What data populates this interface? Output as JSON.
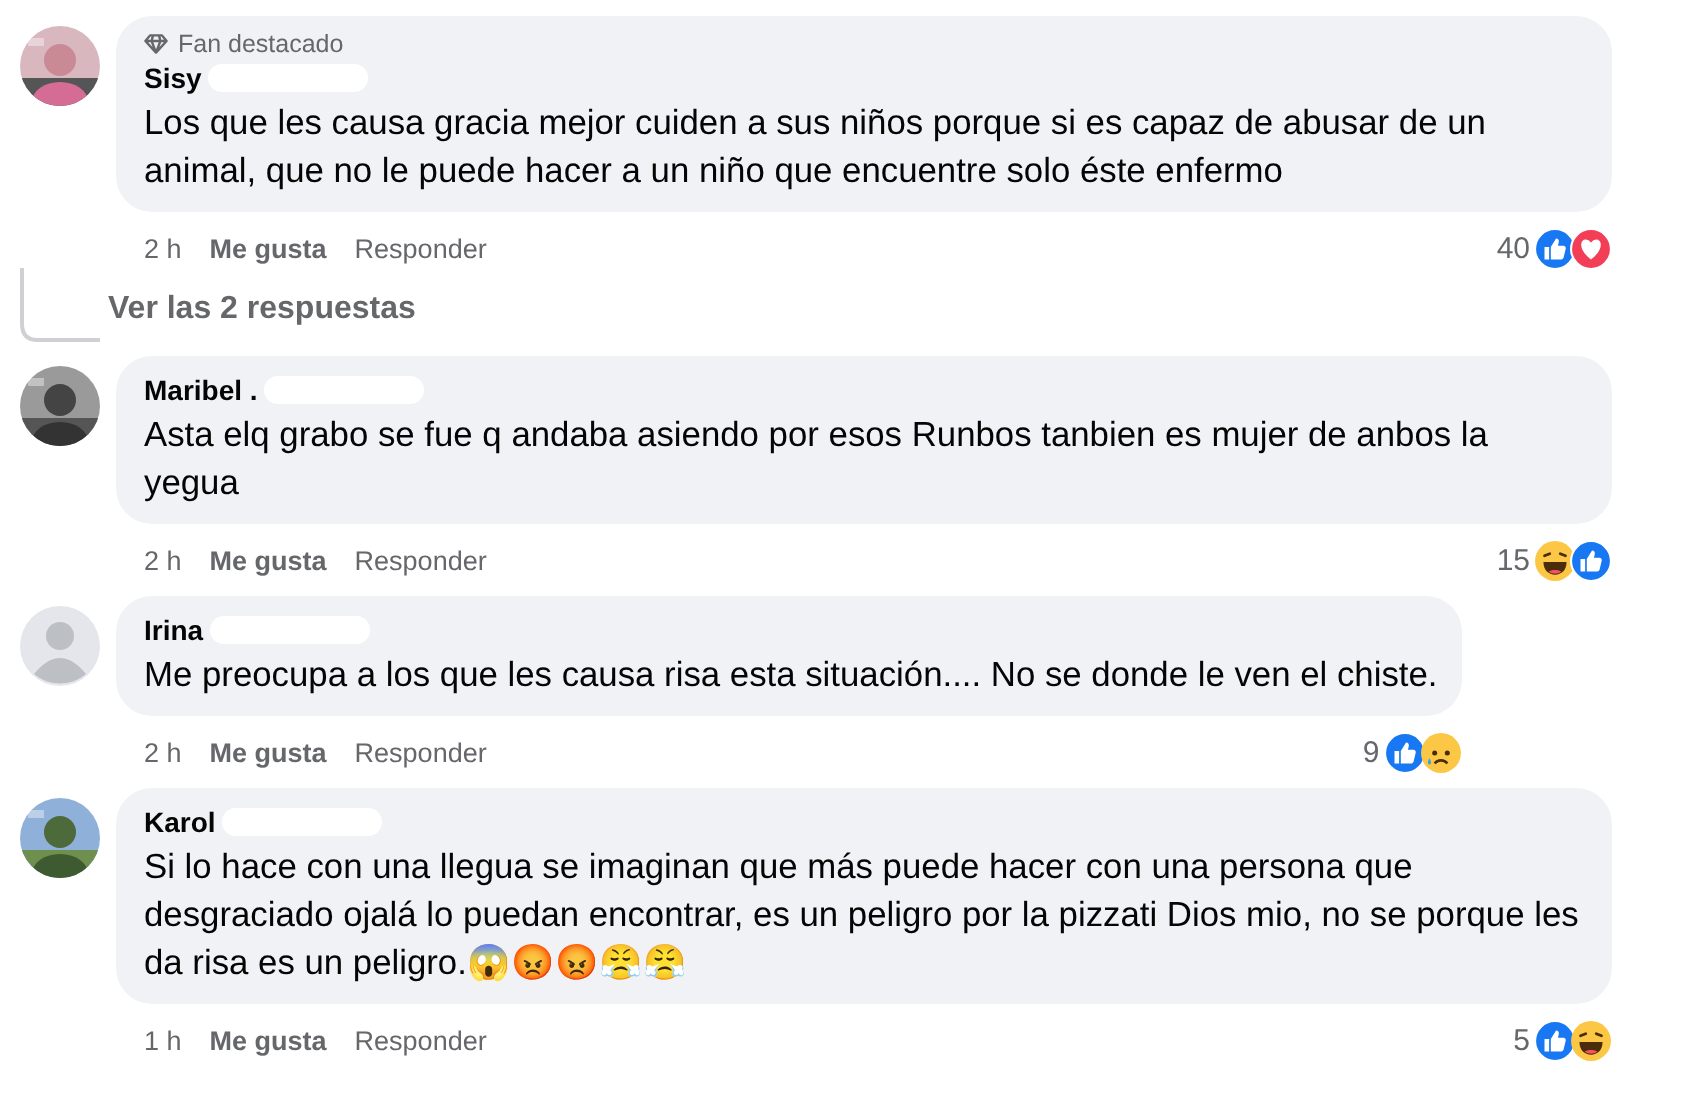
{
  "comments": [
    {
      "badge": "Fan destacado",
      "name": "Sisy",
      "text": "Los que les causa gracia mejor cuiden a sus niños porque si es capaz de abusar de un animal, que no le puede hacer a un niño que encuentre solo éste enfermo",
      "time": "2 h",
      "like": "Me gusta",
      "reply": "Responder",
      "reaction_count": "40",
      "reactions": [
        {
          "kind": "like"
        },
        {
          "kind": "love"
        }
      ],
      "replies_link": "Ver las 2 respuestas"
    },
    {
      "name": "Maribel .",
      "text": "Asta elq grabo se fue q andaba asiendo por esos Runbos tanbien es mujer de anbos la yegua",
      "time": "2 h",
      "like": "Me gusta",
      "reply": "Responder",
      "reaction_count": "15",
      "reactions": [
        {
          "kind": "haha"
        },
        {
          "kind": "like"
        }
      ]
    },
    {
      "avatar": {
        "kind": "default"
      },
      "name": "Irina",
      "text": "Me preocupa a los que les causa risa esta situación.... No se donde le ven el chiste.",
      "time": "2 h",
      "like": "Me gusta",
      "reply": "Responder",
      "reaction_count": "9",
      "reactions": [
        {
          "kind": "like"
        },
        {
          "kind": "sad"
        }
      ]
    },
    {
      "name": "Karol",
      "text": "Si lo hace con una llegua se imaginan que más puede hacer con una persona que desgraciado ojalá lo puedan encontrar, es un peligro por la pizzati Dios mio, no se porque les da risa es un peligro.😱😡😡😤😤",
      "time": "1 h",
      "like": "Me gusta",
      "reply": "Responder",
      "reaction_count": "5",
      "reactions": [
        {
          "kind": "like"
        },
        {
          "kind": "haha"
        }
      ]
    }
  ]
}
